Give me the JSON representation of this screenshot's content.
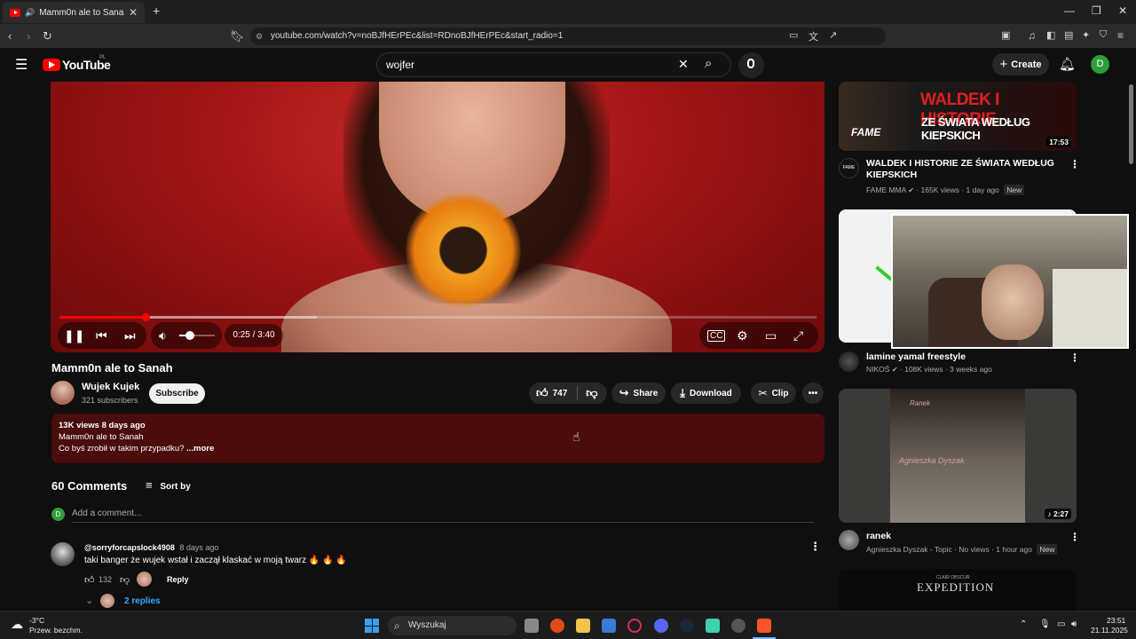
{
  "browser": {
    "tab_title": "Mamm0n ale to Sanah - YouTube",
    "url": "youtube.com/watch?v=noBJfHErPEc&list=RDnoBJfHErPEc&start_radio=1",
    "new_tab_icon": "plus-icon",
    "window_controls": [
      "minimize",
      "restore",
      "close"
    ]
  },
  "youtube": {
    "logo_text": "YouTube",
    "country_code": "PL",
    "search_value": "wojfer",
    "create_label": "Create",
    "avatar_letter": "D"
  },
  "player": {
    "current_time": "0:25 / 3:40",
    "progress_fraction": 0.114,
    "buffered_fraction": 0.34,
    "volume_fraction": 0.3
  },
  "video": {
    "title": "Mamm0n ale to Sanah",
    "channel_name": "Wujek Kujek",
    "subscribers": "321 subscribers",
    "subscribe_label": "Subscribe",
    "likes": "747",
    "share_label": "Share",
    "download_label": "Download",
    "clip_label": "Clip",
    "description": {
      "stats": "13K views  8 days ago",
      "line1": "Mamm0n ale to Sanah",
      "line2": "Co byś zrobił w takim przypadku?",
      "more": "...more"
    }
  },
  "comments": {
    "count_label": "60 Comments",
    "sort_label": "Sort by",
    "add_placeholder": "Add a comment...",
    "user_initial": "D",
    "items": [
      {
        "author": "@sorryforcapslock4908",
        "time": "8 days ago",
        "text": "taki banger że wujek wstał i zaczął klaskać w moją twarz 🔥 🔥 🔥",
        "likes": "132",
        "reply_label": "Reply",
        "replies_label": "2 replies"
      }
    ]
  },
  "recommendations": [
    {
      "title": "WALDEK I HISTORIE ZE ŚWIATA WEDŁUG KIEPSKICH",
      "thumb_text_1": "WALDEK I HISTORIE",
      "thumb_text_2": "ZE ŚWIATA WEDŁUG KIEPSKICH",
      "thumb_brand": "FAME",
      "channel": "FAME MMA",
      "views": "165K views",
      "time": "1 day ago",
      "badge": "New",
      "duration": "17:53",
      "channel_icon_text": "FAME"
    },
    {
      "title": "lamine yamal freestyle",
      "channel": "NIKOŚ",
      "views": "108K views",
      "time": "3 weeks ago"
    },
    {
      "title": "ranek",
      "thumb_text_1": "Ranek",
      "thumb_text_2": "Agnieszka Dyszak",
      "channel": "Agnieszka Dyszak - Topic",
      "views": "No views",
      "time": "1 hour ago",
      "badge": "New",
      "duration": "2:27"
    },
    {
      "thumb_text_1": "EXPEDITION",
      "thumb_text_small": "CLAIR OBSCUR"
    }
  ],
  "taskbar": {
    "weather_temp": "-3°C",
    "weather_desc": "Przew. bezchm.",
    "search_label": "Wyszukaj",
    "time": "23:51",
    "date": "21.11.2025"
  },
  "colors": {
    "yt_red": "#ff0000",
    "desc_bg": "#4a0c0c",
    "avatar_green": "#2e9e3a"
  }
}
